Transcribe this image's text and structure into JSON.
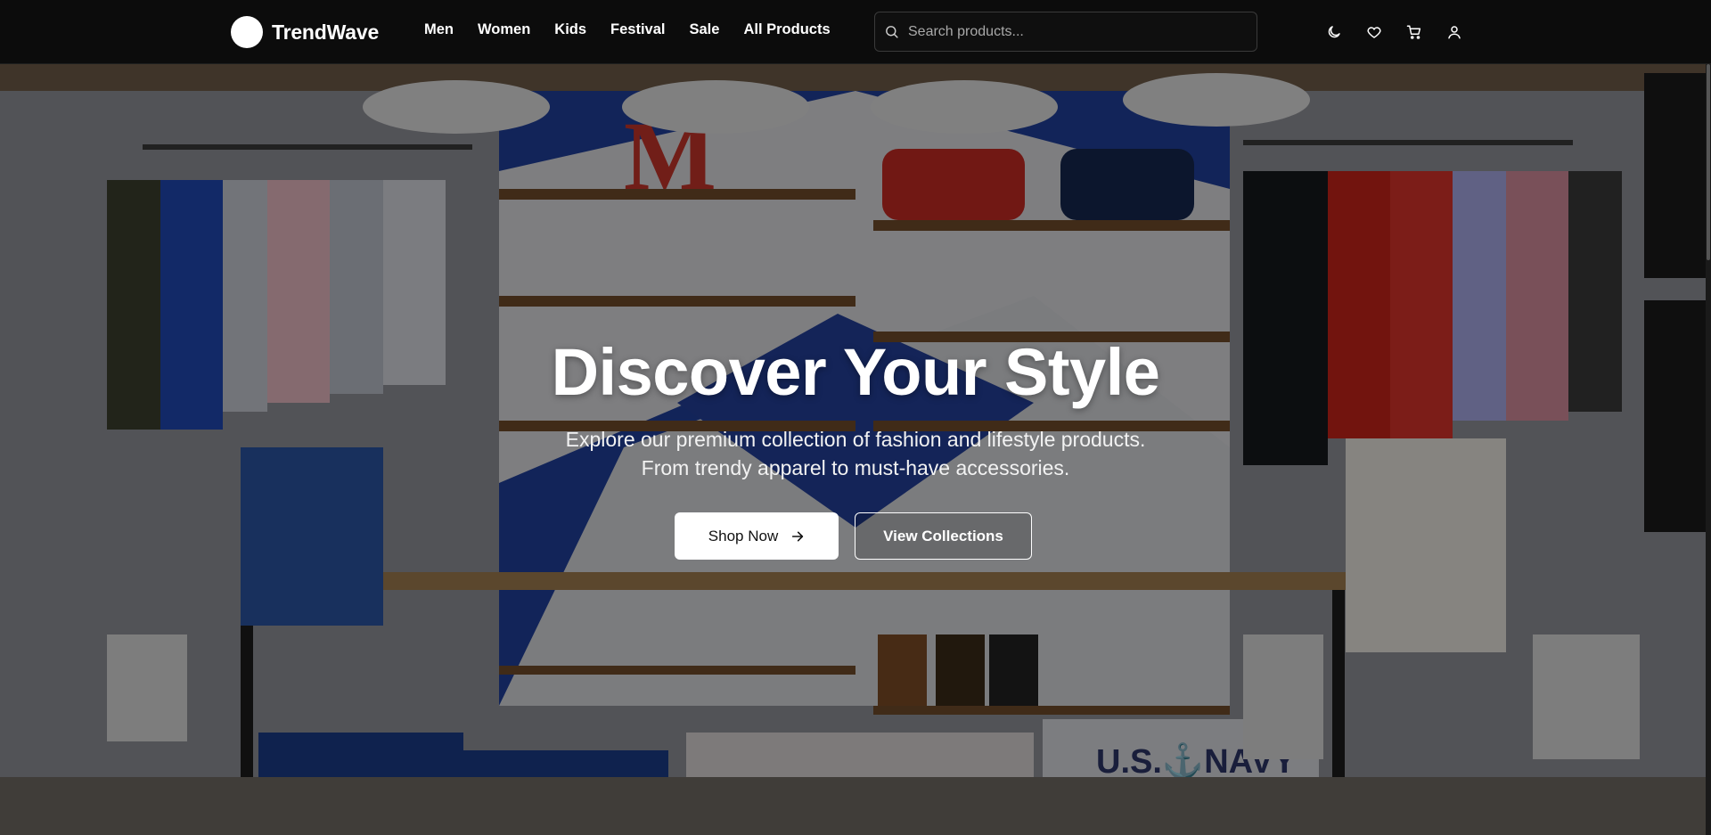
{
  "brand": {
    "name": "TrendWave"
  },
  "nav": {
    "items": [
      {
        "label": "Men"
      },
      {
        "label": "Women"
      },
      {
        "label": "Kids"
      },
      {
        "label": "Festival"
      },
      {
        "label": "Sale"
      },
      {
        "label": "All Products"
      }
    ]
  },
  "search": {
    "placeholder": "Search products...",
    "value": ""
  },
  "header_icons": [
    "moon-icon",
    "heart-icon",
    "cart-icon",
    "user-icon"
  ],
  "hero": {
    "title": "Discover Your Style",
    "subtitle_line1": "Explore our premium collection of fashion and lifestyle products.",
    "subtitle_line2": "From trendy apparel to must-have accessories.",
    "primary_button": "Shop Now",
    "secondary_button": "View Collections",
    "background": "store-interior-photo"
  },
  "colors": {
    "header_bg": "#0c0c0c",
    "primary_button_bg": "#ffffff",
    "text": "#ffffff"
  }
}
